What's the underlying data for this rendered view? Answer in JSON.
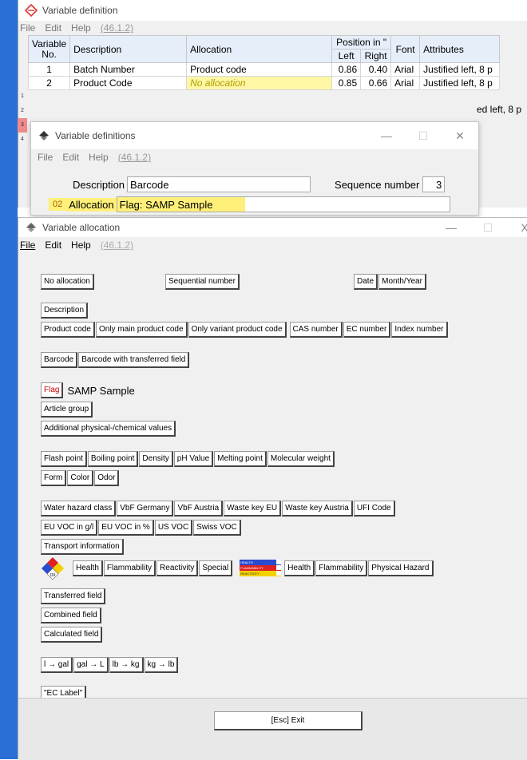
{
  "window1": {
    "title": "Variable definition",
    "menu": {
      "file": "File",
      "edit": "Edit",
      "help": "Help",
      "version": "(46.1.2)"
    },
    "table": {
      "headers": {
        "variable": "Variable",
        "no": "No.",
        "description": "Description",
        "allocation": "Allocation",
        "position": "Position in \"",
        "left": "Left",
        "right": "Right",
        "font": "Font",
        "attributes": "Attributes"
      },
      "row_numbers": [
        "1",
        "2",
        "3",
        "4"
      ],
      "rows": [
        {
          "no": "1",
          "description": "Batch Number",
          "allocation": "Product code",
          "left": "0.86",
          "right": "0.40",
          "font": "Arial",
          "attributes": "Justified left, 8 p"
        },
        {
          "no": "2",
          "description": "Product Code",
          "allocation": "No allocation",
          "left": "0.85",
          "right": "0.66",
          "font": "Arial",
          "attributes": "Justified left, 8 p"
        }
      ],
      "peek_attribute": "ed left, 8 p"
    }
  },
  "window2": {
    "title": "Variable definitions",
    "menu": {
      "file": "File",
      "edit": "Edit",
      "help": "Help",
      "version": "(46.1.2)"
    },
    "description_label": "Description",
    "description_value": "Barcode",
    "sequence_label": "Sequence number",
    "sequence_value": "3",
    "allocation_index": "02",
    "allocation_label": "Allocation",
    "allocation_value": "Flag: SAMP Sample",
    "controls": {
      "minimize": "—",
      "maximize": "☐",
      "close": "✕"
    }
  },
  "window3": {
    "title": "Variable allocation",
    "menu": {
      "file": "File",
      "edit": "Edit",
      "help": "Help",
      "version": "(46.1.2)"
    },
    "controls": {
      "minimize": "—",
      "maximize": "☐",
      "close": "X"
    },
    "buttons": {
      "no_allocation": "No allocation",
      "sequential_number": "Sequential number",
      "date": "Date",
      "month_year": "Month/Year",
      "description": "Description",
      "product_code": "Product code",
      "only_main_product_code": "Only main product code",
      "only_variant_product_code": "Only variant product code",
      "cas_number": "CAS number",
      "ec_number": "EC number",
      "index_number": "Index number",
      "barcode": "Barcode",
      "barcode_transferred": "Barcode with transferred field",
      "flag": "Flag",
      "flag_value": "SAMP Sample",
      "article_group": "Article group",
      "additional_values": "Additional physical-/chemical values",
      "flash_point": "Flash point",
      "boiling_point": "Boiling point",
      "density": "Density",
      "ph_value": "pH Value",
      "melting_point": "Melting point",
      "molecular_weight": "Molecular weight",
      "form": "Form",
      "color": "Color",
      "odor": "Odor",
      "water_hazard": "Water hazard class",
      "vbf_germany": "VbF Germany",
      "vbf_austria": "VbF Austria",
      "waste_key_eu": "Waste key EU",
      "waste_key_austria": "Waste key Austria",
      "ufi_code": "UFI Code",
      "eu_voc_gl": "EU VOC in g/l",
      "eu_voc_pct": "EU VOC in %",
      "us_voc": "US VOC",
      "swiss_voc": "Swiss VOC",
      "transport_info": "Transport information",
      "nfpa_health": "Health",
      "nfpa_flammability": "Flammability",
      "nfpa_reactivity": "Reactivity",
      "nfpa_special": "Special",
      "hmis_health": "Health",
      "hmis_flammability": "Flammability",
      "hmis_physical": "Physical Hazard",
      "transferred_field": "Transferred field",
      "combined_field": "Combined field",
      "calculated_field": "Calculated field",
      "l_gal": "l → gal",
      "gal_l": "gal → L",
      "lb_kg": "lb → kg",
      "kg_lb": "kg → lb",
      "ec_label": "\"EC Label\"",
      "exit": "[Esc] Exit"
    },
    "hmis_labels": {
      "health": "HEALTH",
      "flammability": "FLAMMABILITY",
      "reactivity": "REACTIVITY"
    }
  },
  "colors": {
    "accent_blue": "#2b6fd6",
    "highlight_yellow": "#fff07a",
    "flag_red": "#d00000"
  }
}
